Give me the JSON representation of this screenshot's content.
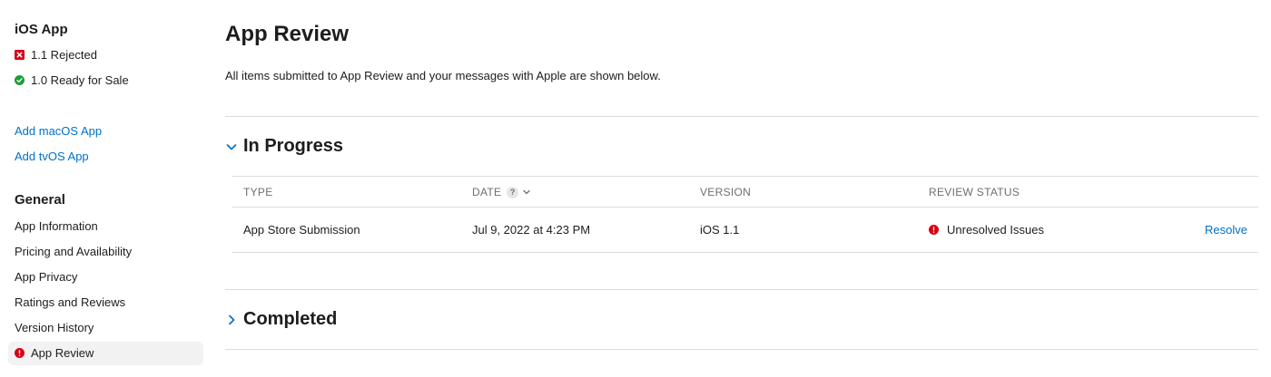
{
  "sidebar": {
    "platform_heading": "iOS App",
    "versions": [
      {
        "label": "1.1 Rejected",
        "status": "rejected"
      },
      {
        "label": "1.0 Ready for Sale",
        "status": "ready"
      }
    ],
    "add_links": [
      {
        "label": "Add macOS App"
      },
      {
        "label": "Add tvOS App"
      }
    ],
    "general_heading": "General",
    "general_items": [
      {
        "label": "App Information"
      },
      {
        "label": "Pricing and Availability"
      },
      {
        "label": "App Privacy"
      },
      {
        "label": "Ratings and Reviews"
      },
      {
        "label": "Version History"
      },
      {
        "label": "App Review",
        "active": true
      }
    ]
  },
  "main": {
    "title": "App Review",
    "subtitle": "All items submitted to App Review and your messages with Apple are shown below.",
    "in_progress": {
      "title": "In Progress",
      "expanded": true,
      "columns": {
        "type": "TYPE",
        "date": "DATE",
        "date_help": "?",
        "version": "VERSION",
        "review_status": "REVIEW STATUS"
      },
      "rows": [
        {
          "type": "App Store Submission",
          "date": "Jul 9, 2022 at 4:23 PM",
          "version": "iOS 1.1",
          "status": "Unresolved Issues",
          "action": "Resolve"
        }
      ]
    },
    "completed": {
      "title": "Completed",
      "expanded": false
    }
  },
  "colors": {
    "link": "#0070c9",
    "error_red": "#d70015",
    "success_green": "#1a9e3a",
    "muted_text": "#6e6e73",
    "divider": "#dcdcdc"
  }
}
